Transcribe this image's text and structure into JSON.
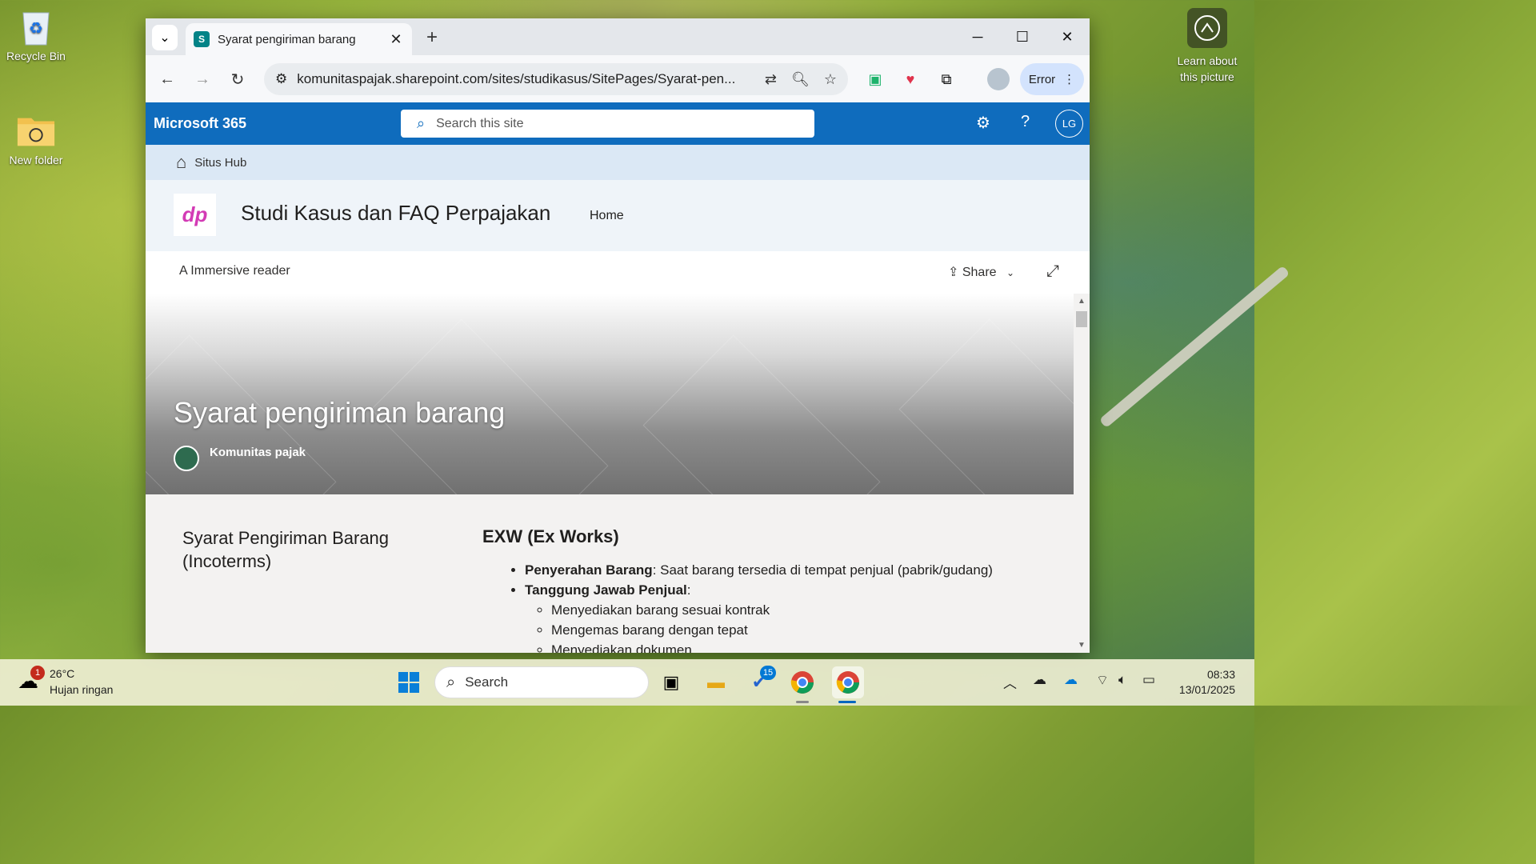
{
  "desktop": {
    "icons": [
      {
        "label": "Recycle Bin"
      },
      {
        "label": "New folder"
      }
    ],
    "learn_about": "Learn about this picture"
  },
  "browser": {
    "tab_title": "Syarat pengiriman barang",
    "url": "komunitaspajak.sharepoint.com/sites/studikasus/SitePages/Syarat-pen...",
    "profile_button": "Error"
  },
  "sharepoint": {
    "brand": "Microsoft 365",
    "search_placeholder": "Search this site",
    "avatar_initials": "LG",
    "hub_name": "Situs Hub",
    "site_title": "Studi Kasus dan FAQ Perpajakan",
    "nav_home": "Home",
    "immersive_reader": "Immersive reader",
    "share": "Share",
    "page_title": "Syarat pengiriman barang",
    "author": "Komunitas pajak",
    "left_heading": "Syarat Pengiriman Barang (Incoterms)",
    "section_heading": "EXW (Ex Works)",
    "bullets": [
      {
        "bold": "Penyerahan Barang",
        "text": ": Saat barang tersedia di tempat penjual (pabrik/gudang)"
      },
      {
        "bold": "Tanggung Jawab Penjual",
        "text": ":"
      }
    ],
    "sub_bullets": [
      "Menyediakan barang sesuai kontrak",
      "Mengemas barang dengan tepat",
      "Menyediakan dokumen..."
    ]
  },
  "taskbar": {
    "weather_temp": "26°C",
    "weather_desc": "Hujan ringan",
    "weather_badge": "1",
    "search_label": "Search",
    "todo_badge": "15",
    "time": "08:33",
    "date": "13/01/2025"
  }
}
